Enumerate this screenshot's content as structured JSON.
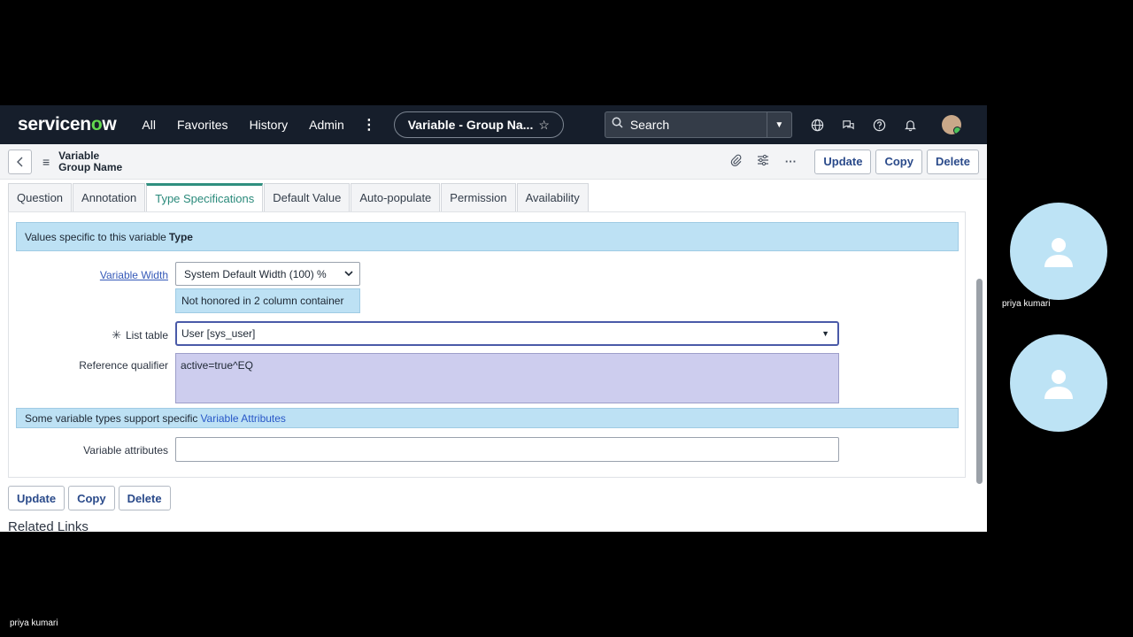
{
  "topbar": {
    "logo_pre": "servicen",
    "logo_o": "o",
    "logo_post": "w",
    "nav": [
      "All",
      "Favorites",
      "History",
      "Admin"
    ],
    "context_title": "Variable - Group Na...",
    "search_label": "Search"
  },
  "form_header": {
    "title_line1": "Variable",
    "title_line2": "Group Name",
    "buttons": {
      "update": "Update",
      "copy": "Copy",
      "delete": "Delete"
    }
  },
  "tabs": [
    {
      "label": "Question"
    },
    {
      "label": "Annotation"
    },
    {
      "label": "Type Specifications"
    },
    {
      "label": "Default Value"
    },
    {
      "label": "Auto-populate"
    },
    {
      "label": "Permission"
    },
    {
      "label": "Availability"
    }
  ],
  "active_tab": "Type Specifications",
  "type_spec": {
    "info_prefix": "Values specific to this variable",
    "info_bold": "Type",
    "variable_width_label": "Variable Width",
    "variable_width_value": "System Default Width (100) %",
    "width_note": "Not honored in 2 column container",
    "list_table_label": "List table",
    "list_table_value": "User [sys_user]",
    "ref_qual_label": "Reference qualifier",
    "ref_qual_value": "active=true^EQ",
    "attrs_info_prefix": "Some variable types support specific",
    "attrs_info_link": "Variable Attributes",
    "variable_attrs_label": "Variable attributes",
    "variable_attrs_value": ""
  },
  "bottom_buttons": {
    "update": "Update",
    "copy": "Copy",
    "delete": "Delete"
  },
  "related_links": "Related Links",
  "participants": {
    "name": "priya kumari",
    "self_name": "priya kumari"
  },
  "colors": {
    "topbar": "#161e2b",
    "accent_tab": "#2f8f7f",
    "info_bar": "#bde1f4",
    "textarea": "#cdcdee",
    "brand_green": "#62d84e"
  }
}
